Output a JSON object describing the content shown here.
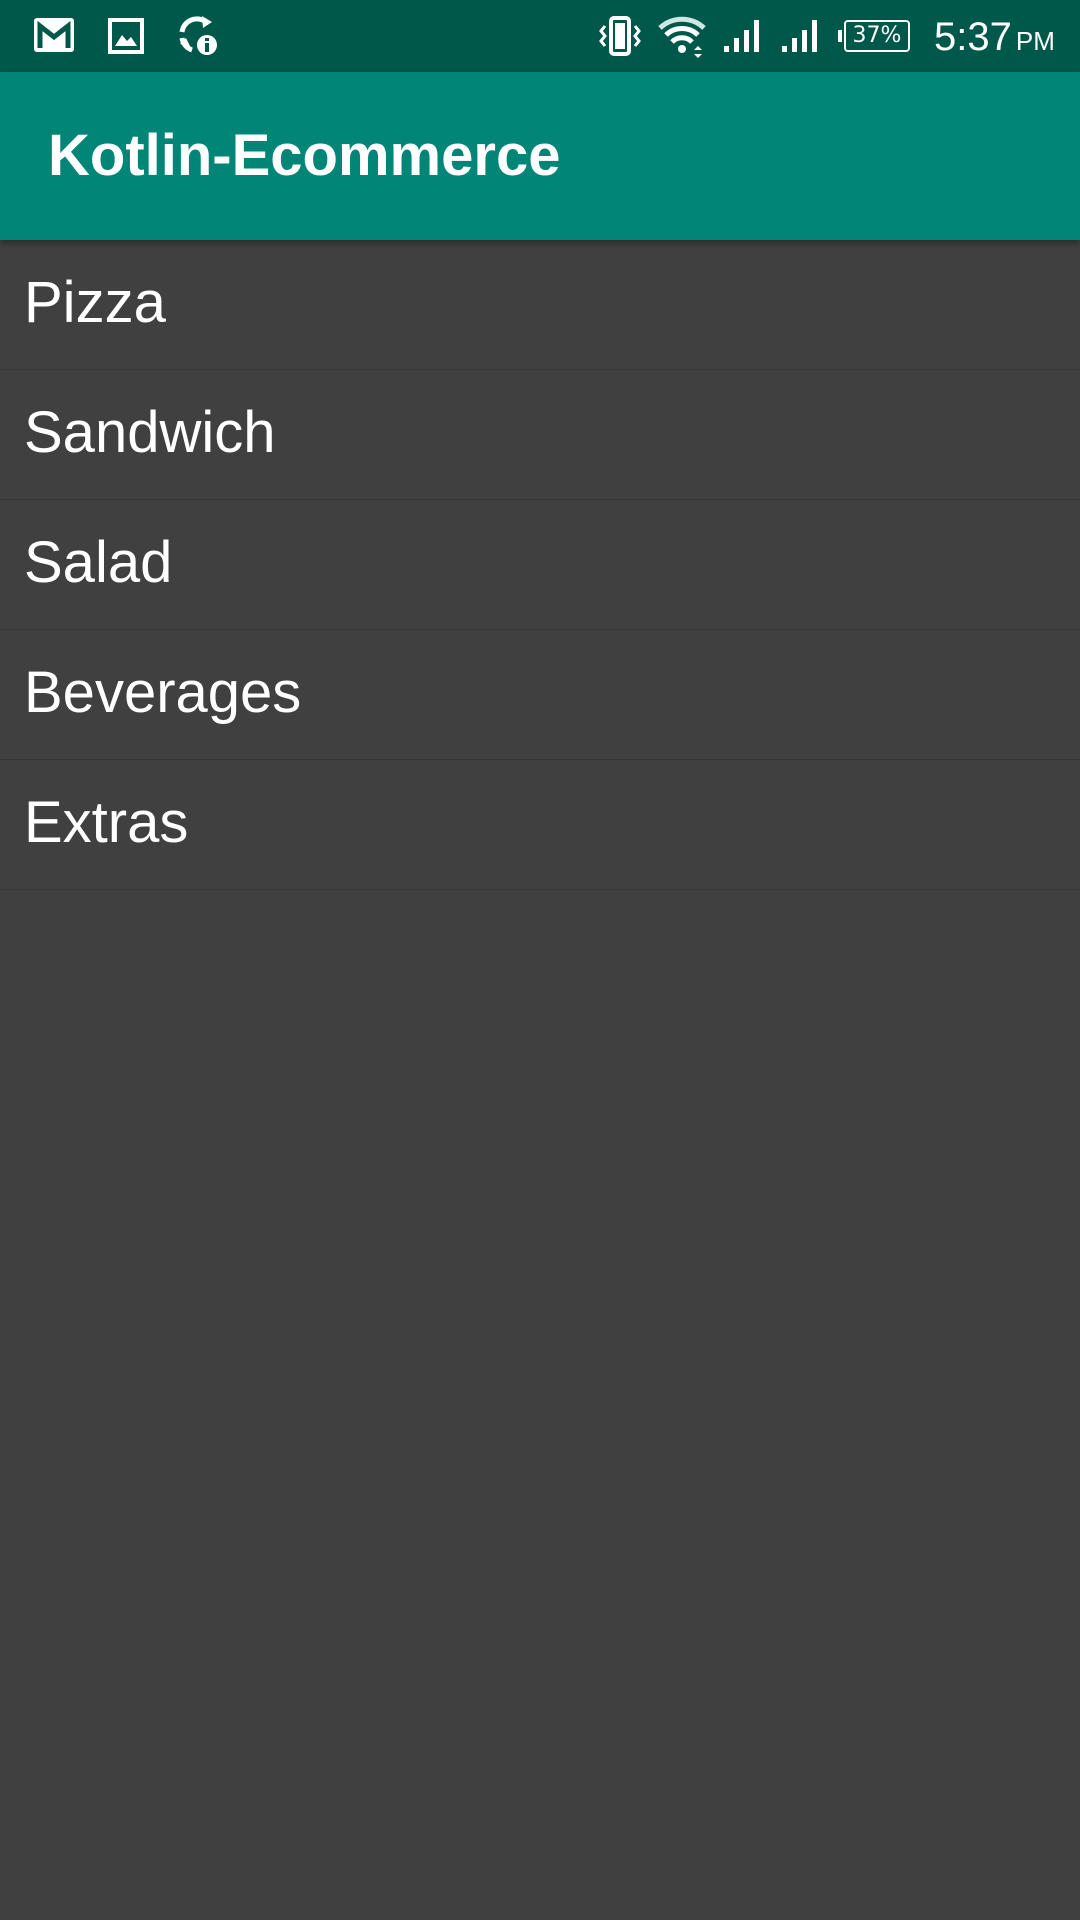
{
  "status_bar": {
    "battery_text": "37%",
    "time": "5:37",
    "ampm": "PM",
    "left_icons": [
      "gmail-icon",
      "gallery-icon",
      "sync-info-icon"
    ],
    "right_icons": [
      "vibrate-icon",
      "wifi-icon",
      "signal-icon",
      "signal-icon",
      "battery-icon"
    ]
  },
  "app_bar": {
    "title": "Kotlin-Ecommerce"
  },
  "categories": [
    {
      "label": "Pizza"
    },
    {
      "label": "Sandwich"
    },
    {
      "label": "Salad"
    },
    {
      "label": "Beverages"
    },
    {
      "label": "Extras"
    }
  ],
  "colors": {
    "status_bar": "#00584B",
    "app_bar": "#008577",
    "background": "#404040",
    "text": "#FFFFFF"
  }
}
